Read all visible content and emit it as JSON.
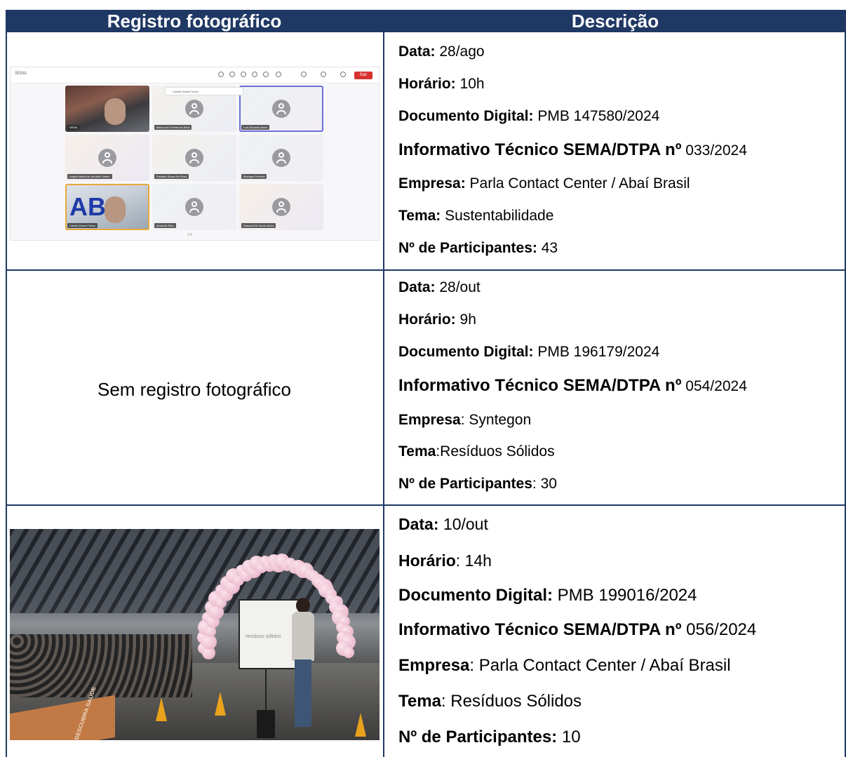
{
  "header": {
    "col1": "Registro fotográfico",
    "col2": "Descrição"
  },
  "rows": [
    {
      "photo": {
        "sema_label": "SEMA",
        "sair_label": "Sair",
        "popup_name": "Camila Dama Furfoo",
        "pager": "1/3",
        "tiles": [
          "SEMA",
          "Maria com Fontes da Silva",
          "Luis Eduardo Alves",
          "Angela Maria de carvalho ribeiro",
          "Fabiana Sousa da Rosa",
          "Monique Ferreira",
          "Camila Dama Furfoo",
          "Amanda Silva",
          "Samara De Souza Alves"
        ]
      },
      "fields": [
        {
          "key": "Data:",
          "value": " 28/ago"
        },
        {
          "key": "Horário:",
          "value": " 10h"
        },
        {
          "key": "Documento Digital:",
          "value": " PMB 147580/2024"
        },
        {
          "key": "Informativo Técnico SEMA/DTPA nº",
          "value": " 033/2024"
        },
        {
          "key": "Empresa:",
          "value": " Parla Contact Center / Abaí Brasil"
        },
        {
          "key": "Tema:",
          "value": " Sustentabilidade"
        },
        {
          "key": "Nº de Participantes:",
          "value": " 43"
        }
      ]
    },
    {
      "no_photo": "Sem registro fotográfico",
      "fields": [
        {
          "key": "Data:",
          "value": " 28/out"
        },
        {
          "key": "Horário:",
          "value": " 9h"
        },
        {
          "key": "Documento Digital:",
          "value": " PMB 196179/2024"
        },
        {
          "key": "Informativo Técnico SEMA/DTPA nº",
          "value": " 054/2024"
        },
        {
          "key": "Empresa",
          "value": ": Syntegon"
        },
        {
          "key": "Tema",
          "value": ":Resíduos Sólidos"
        },
        {
          "key": "Nº de Participantes",
          "value": ": 30"
        }
      ]
    },
    {
      "photo": {
        "screen_text": "resíduos sólidos",
        "table_text": "DESCUBRA SAÚDE"
      },
      "fields": [
        {
          "key": "Data:",
          "value": " 10/out"
        },
        {
          "key": "Horário",
          "value": ": 14h"
        },
        {
          "key": "Documento Digital:",
          "value": " PMB 199016/2024"
        },
        {
          "key": "Informativo Técnico SEMA/DTPA nº",
          "value": " 056/2024"
        },
        {
          "key": "Empresa",
          "value": ": Parla Contact Center / Abaí Brasil"
        },
        {
          "key": "Tema",
          "value": ": Resíduos Sólidos"
        },
        {
          "key": "Nº de Participantes:",
          "value": " 10"
        }
      ]
    }
  ]
}
